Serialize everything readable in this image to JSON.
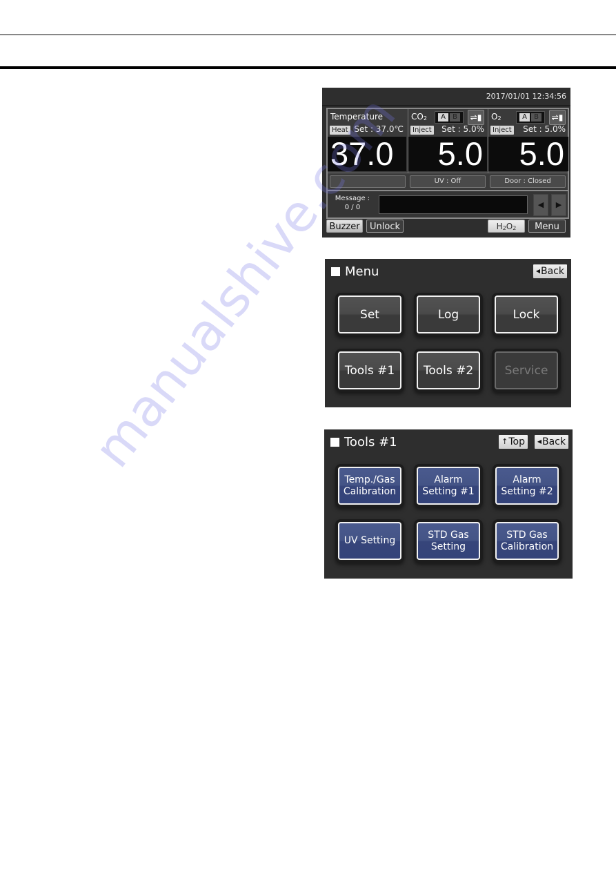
{
  "watermark": "manualshive.com",
  "status_screen": {
    "datetime": "2017/01/01  12:34:56",
    "temperature": {
      "label": "Temperature",
      "mode_tag": "Heat",
      "set_text": "Set : 37.0℃",
      "value": "37.0"
    },
    "co2": {
      "label_main": "CO",
      "label_sub": "2",
      "tag": "Inject",
      "set_text": "Set :  5.0%",
      "value": "5.0",
      "cylinder_a": "A",
      "cylinder_b": "B",
      "gas_switch_icon": "gas-cylinder-switch-icon"
    },
    "o2": {
      "label_main": "O",
      "label_sub": "2",
      "tag": "Inject",
      "set_text": "Set :  5.0%",
      "value": "5.0",
      "cylinder_a": "A",
      "cylinder_b": "B",
      "gas_switch_icon": "gas-cylinder-switch-icon"
    },
    "status_boxes": [
      "",
      "UV : Off",
      "Door : Closed"
    ],
    "message": {
      "label": "Message :",
      "count": "0 / 0",
      "text": "",
      "prev_icon": "◀",
      "next_icon": "▶"
    },
    "buttons": {
      "buzzer": "Buzzer",
      "unlock": "Unlock",
      "h2o2_h": "H",
      "h2o2_2a": "2",
      "h2o2_o": "O",
      "h2o2_2b": "2",
      "menu": "Menu"
    }
  },
  "menu_screen": {
    "title": "Menu",
    "back_glyph": "◀",
    "back_label": "Back",
    "tiles": [
      {
        "label": "Set",
        "enabled": true
      },
      {
        "label": "Log",
        "enabled": true
      },
      {
        "label": "Lock",
        "enabled": true
      },
      {
        "label": "Tools #1",
        "enabled": true
      },
      {
        "label": "Tools #2",
        "enabled": true
      },
      {
        "label": "Service",
        "enabled": false
      }
    ]
  },
  "tools_screen": {
    "title": "Tools #1",
    "top_glyph": "↑",
    "top_label": "Top",
    "back_glyph": "◀",
    "back_label": "Back",
    "tiles": [
      {
        "line1": "Temp./Gas",
        "line2": "Calibration"
      },
      {
        "line1": "Alarm",
        "line2": "Setting #1"
      },
      {
        "line1": "Alarm",
        "line2": "Setting #2"
      },
      {
        "line1": "UV Setting",
        "line2": ""
      },
      {
        "line1": "STD Gas",
        "line2": "Setting"
      },
      {
        "line1": "STD Gas",
        "line2": "Calibration"
      }
    ]
  }
}
